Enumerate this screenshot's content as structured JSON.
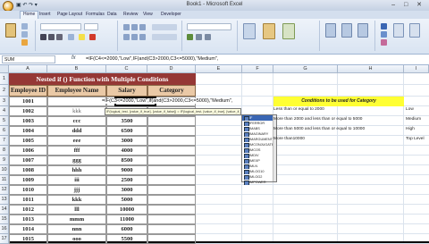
{
  "window": {
    "title": "Book1 - Microsoft Excel",
    "quick_access": "▣ ↶ ↷ ▾",
    "controls": "‒ □ ✕"
  },
  "ribbon": {
    "tabs": [
      "Home",
      "Insert",
      "Page Layout",
      "Formulas",
      "Data",
      "Review",
      "View",
      "Developer"
    ],
    "active_tab": 0
  },
  "formula_bar": {
    "name_box": "SUM",
    "fx": "fx",
    "formula": "=IF(C4<=2000,\"Low\",IF(and(C3>2000,C3<=5000),\"Medium\","
  },
  "sheet": {
    "columns": [
      "A",
      "B",
      "C",
      "D",
      "E",
      "F",
      "G",
      "H",
      "I"
    ],
    "rows": [
      "1",
      "2",
      "3",
      "4",
      "5",
      "6",
      "7",
      "8",
      "9",
      "10",
      "11",
      "12",
      "13",
      "14",
      "15",
      "16",
      "17"
    ],
    "title": "Nested if () Function with Multiple Conditions",
    "headers": [
      "Employee ID",
      "Employee Name",
      "Salary",
      "Category"
    ],
    "data": [
      {
        "id": "1001",
        "name": "",
        "salary": ""
      },
      {
        "id": "1002",
        "name": "kkk",
        "salary": "2500"
      },
      {
        "id": "1003",
        "name": "ccc",
        "salary": "3500"
      },
      {
        "id": "1004",
        "name": "ddd",
        "salary": "6500"
      },
      {
        "id": "1005",
        "name": "eee",
        "salary": "3000"
      },
      {
        "id": "1006",
        "name": "fff",
        "salary": "4000"
      },
      {
        "id": "1007",
        "name": "ggg",
        "salary": "8500"
      },
      {
        "id": "1008",
        "name": "hhh",
        "salary": "9000"
      },
      {
        "id": "1009",
        "name": "iii",
        "salary": "2500"
      },
      {
        "id": "1010",
        "name": "jjj",
        "salary": "3000"
      },
      {
        "id": "1011",
        "name": "kkk",
        "salary": "5000"
      },
      {
        "id": "1012",
        "name": "lll",
        "salary": "10000"
      },
      {
        "id": "1013",
        "name": "mmm",
        "salary": "11000"
      },
      {
        "id": "1014",
        "name": "nnn",
        "salary": "6000"
      },
      {
        "id": "1015",
        "name": "ooo",
        "salary": "5500"
      }
    ],
    "editing_text": "=IF(C3<=2000,\"Low\",if(and(C3>2000,C3<=5000),\"Medium\",",
    "tooltip": "IF(logical_test, [value_if_true], [value_if_false]) = IF(logical_test, [value_if_true], [value_if_false])"
  },
  "autocomplete": {
    "items": [
      "IF",
      "IFERROR",
      "IMABS",
      "IMAGINARY",
      "IMARGUMENT",
      "IMCONJUGATE",
      "IMCOS",
      "IMDIV",
      "IMEXP",
      "IMLN",
      "IMLOG10",
      "IMLOG2",
      "IMPOWER"
    ],
    "selected": 0
  },
  "conditions": {
    "title": "Conditions to be used for Category",
    "rows": [
      {
        "text": "Less than or equal to 2000",
        "value": "Low"
      },
      {
        "text": "More than 2000 and less than or equal to 5000",
        "value": "Medium"
      },
      {
        "text": "More than 5000 and less than or equal to 10000",
        "value": "High"
      },
      {
        "text": "More than10000",
        "value": "Top Level"
      }
    ]
  }
}
